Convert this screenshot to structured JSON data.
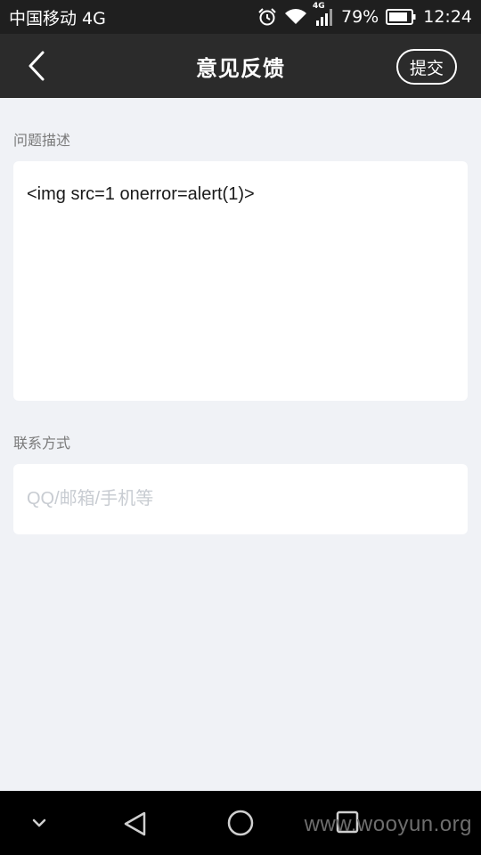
{
  "status_bar": {
    "carrier": "中国移动 4G",
    "network_badge": "4G",
    "battery": "79%",
    "time": "12:24",
    "icons": [
      "alarm-icon",
      "wifi-icon",
      "signal-icon",
      "battery-icon"
    ]
  },
  "header": {
    "title": "意见反馈",
    "submit_label": "提交",
    "back_icon": "chevron-left-icon"
  },
  "form": {
    "description_label": "问题描述",
    "description_value": "<img src=1 onerror=alert(1)>",
    "contact_label": "联系方式",
    "contact_placeholder": "QQ/邮箱/手机等",
    "contact_value": ""
  },
  "nav_bar": {
    "icons": [
      "chevron-down-icon",
      "back-triangle-icon",
      "home-circle-icon",
      "recents-square-icon"
    ]
  },
  "watermark": "www.wooyun.org",
  "colors": {
    "status_bar_bg": "#1f1f1f",
    "header_bg": "#2b2b2b",
    "page_bg": "#f0f2f6",
    "card_bg": "#ffffff",
    "label_text": "#7a7a7a",
    "placeholder_text": "#c8ccd2"
  }
}
